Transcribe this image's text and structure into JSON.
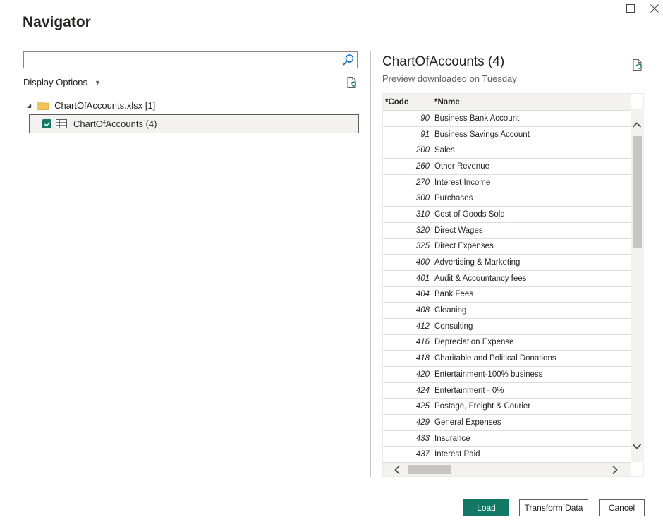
{
  "dialog": {
    "title": "Navigator"
  },
  "search": {
    "value": "",
    "placeholder": ""
  },
  "display_options": {
    "label": "Display Options"
  },
  "tree": {
    "parent": {
      "label": "ChartOfAccounts.xlsx [1]"
    },
    "child": {
      "label": "ChartOfAccounts (4)",
      "checked": true
    }
  },
  "preview": {
    "title": "ChartOfAccounts (4)",
    "subtitle": "Preview downloaded on Tuesday",
    "columns": [
      "*Code",
      "*Name"
    ],
    "rows": [
      [
        "90",
        "Business Bank Account"
      ],
      [
        "91",
        "Business Savings Account"
      ],
      [
        "200",
        "Sales"
      ],
      [
        "260",
        "Other Revenue"
      ],
      [
        "270",
        "Interest Income"
      ],
      [
        "300",
        "Purchases"
      ],
      [
        "310",
        "Cost of Goods Sold"
      ],
      [
        "320",
        "Direct Wages"
      ],
      [
        "325",
        "Direct Expenses"
      ],
      [
        "400",
        "Advertising & Marketing"
      ],
      [
        "401",
        "Audit & Accountancy fees"
      ],
      [
        "404",
        "Bank Fees"
      ],
      [
        "408",
        "Cleaning"
      ],
      [
        "412",
        "Consulting"
      ],
      [
        "416",
        "Depreciation Expense"
      ],
      [
        "418",
        "Charitable and Political Donations"
      ],
      [
        "420",
        "Entertainment-100% business"
      ],
      [
        "424",
        "Entertainment - 0%"
      ],
      [
        "425",
        "Postage, Freight & Courier"
      ],
      [
        "429",
        "General Expenses"
      ],
      [
        "433",
        "Insurance"
      ],
      [
        "437",
        "Interest Paid"
      ]
    ]
  },
  "buttons": {
    "load": "Load",
    "transform": "Transform Data",
    "cancel": "Cancel"
  },
  "colors": {
    "accent": "#117865"
  }
}
